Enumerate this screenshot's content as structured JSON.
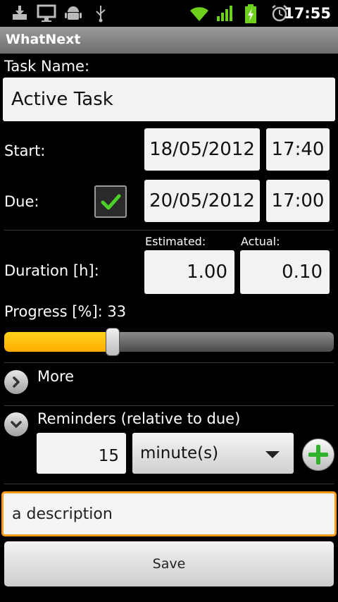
{
  "status_bar": {
    "time": "17:55",
    "icons": [
      "download-icon",
      "monitor-icon",
      "android-icon",
      "usb-icon",
      "wifi-icon",
      "signal-icon",
      "battery-charging-icon",
      "alarm-icon"
    ]
  },
  "app": {
    "title": "WhatNext"
  },
  "task_name": {
    "label": "Task Name:",
    "value": "Active Task"
  },
  "start": {
    "label": "Start:",
    "date": "18/05/2012",
    "time": "17:40"
  },
  "due": {
    "label": "Due:",
    "checked": true,
    "date": "20/05/2012",
    "time": "17:00"
  },
  "duration": {
    "label": "Duration [h]:",
    "estimated_label": "Estimated:",
    "estimated": "1.00",
    "actual_label": "Actual:",
    "actual": "0.10"
  },
  "progress": {
    "label": "Progress [%]:",
    "value": "33",
    "percent": 33
  },
  "more": {
    "label": "More",
    "icon": "chevron-right-icon"
  },
  "reminders": {
    "label": "Reminders (relative to due)",
    "icon": "chevron-down-icon",
    "amount": "15",
    "unit": "minute(s)",
    "add_icon": "plus-icon"
  },
  "description": {
    "value": "a description"
  },
  "save_label": "Save",
  "colors": {
    "accent": "#ffad00",
    "focus_border": "#ff9b19",
    "check_green": "#4cd02a",
    "plus_green": "#2fb32a"
  }
}
